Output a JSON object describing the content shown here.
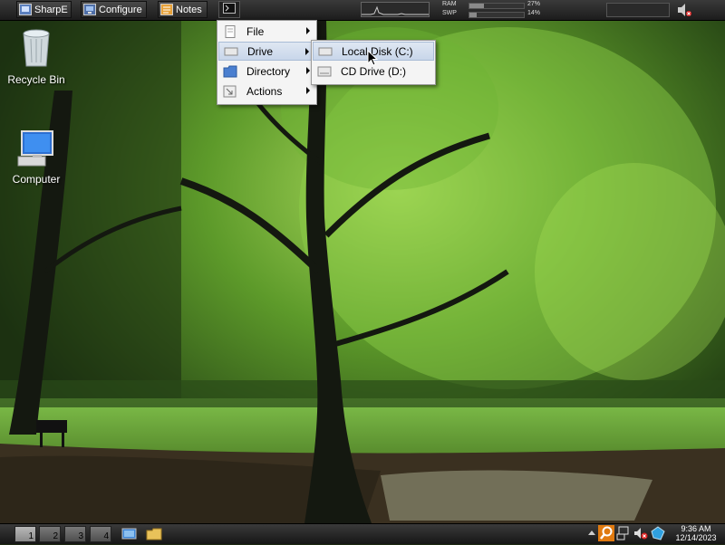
{
  "top_panel": {
    "launchers": [
      {
        "label": "SharpE",
        "icon": "sharpe-icon"
      },
      {
        "label": "Configure",
        "icon": "configure-icon"
      },
      {
        "label": "Notes",
        "icon": "notes-icon"
      }
    ],
    "terminal_icon": "terminal-icon",
    "memory": {
      "ram_label": "RAM",
      "ram_percent": "27%",
      "ram_value": 27,
      "swap_label": "SWP",
      "swap_percent": "14%",
      "swap_value": 14
    },
    "volume_icon": "speaker-muted-icon"
  },
  "desktop_icons": [
    {
      "label": "Recycle Bin",
      "icon": "recycle-bin-icon"
    },
    {
      "label": "Computer",
      "icon": "computer-icon"
    }
  ],
  "context_menu": {
    "items": [
      {
        "label": "File",
        "icon": "file-icon",
        "has_submenu": true
      },
      {
        "label": "Drive",
        "icon": "drive-icon",
        "has_submenu": true,
        "highlighted": true
      },
      {
        "label": "Directory",
        "icon": "folder-icon",
        "has_submenu": true
      },
      {
        "label": "Actions",
        "icon": "actions-icon",
        "has_submenu": true
      }
    ]
  },
  "drive_submenu": {
    "items": [
      {
        "label": "Local Disk (C:)",
        "icon": "hard-disk-icon",
        "highlighted": true
      },
      {
        "label": "CD Drive (D:)",
        "icon": "cd-drive-icon"
      }
    ]
  },
  "bottom_panel": {
    "workspaces": [
      "1",
      "2",
      "3",
      "4"
    ],
    "active_workspace": "1",
    "quick_launch": [
      "show-desktop-icon",
      "file-manager-icon"
    ],
    "tray_icons": [
      "search-icon",
      "network-icon",
      "volume-muted-icon",
      "app-tray-icon"
    ],
    "clock": {
      "time": "9:36 AM",
      "date": "12/14/2023"
    }
  },
  "colors": {
    "panel": "#2a2a2a",
    "menu_bg": "#f4f4f4",
    "menu_highlight": "#c8d6ea"
  }
}
